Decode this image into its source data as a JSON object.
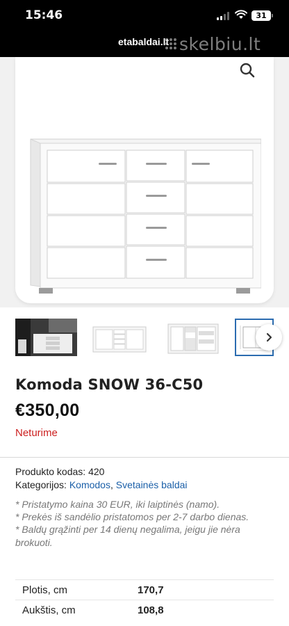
{
  "status_bar": {
    "time": "15:46",
    "battery": "31"
  },
  "url_bar": {
    "domain": "etabaldai.lt",
    "watermark": "skelbiu.lt"
  },
  "product": {
    "title": "Komoda SNOW 36-C50",
    "price": "€350,00",
    "stock": "Neturime",
    "code_label": "Produkto kodas:",
    "code_value": "420",
    "categories_label": "Kategorijos:",
    "categories": [
      "Komodos",
      "Svetainės baldai"
    ],
    "category_separator": ",",
    "notes": [
      "* Pristatymo kaina 30 EUR, iki laiptinės (namo).",
      "* Prekės iš sandėlio pristatomos per 2-7 darbo dienas.",
      "* Baldų grąžinti per 14 dienų negalima, jeigu jie nėra brokuoti."
    ]
  },
  "specs": [
    {
      "label": "Plotis, cm",
      "value": "170,7"
    },
    {
      "label": "Aukštis, cm",
      "value": "108,8"
    }
  ],
  "gallery": {
    "thumbnail_count": 4,
    "selected_index": 3
  },
  "colors": {
    "price": "#111111",
    "stock_out": "#cc1f1f",
    "link": "#1a5fa8",
    "selected_thumb_border": "#2b6cb0"
  },
  "icons": {
    "zoom": "magnifier-icon",
    "next": "chevron-right-icon"
  }
}
